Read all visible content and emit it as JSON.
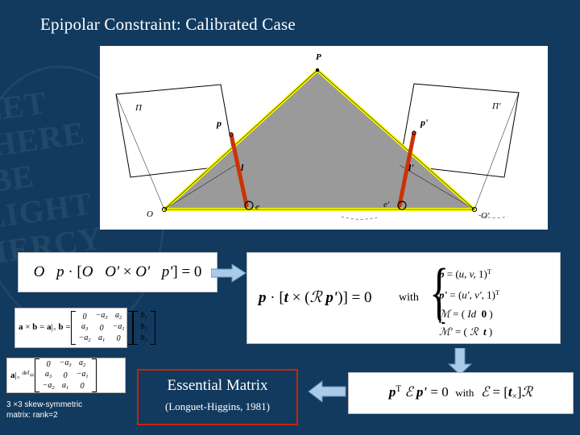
{
  "slide": {
    "title": "Epipolar Constraint: Calibrated Case",
    "background_color": "#123a5e",
    "watermark_lines": [
      "LET",
      "THERE",
      "BE",
      "LIGHT",
      "MERCY"
    ]
  },
  "figure": {
    "name": "epipolar-geometry-diagram",
    "labels": {
      "P": "P",
      "p": "p",
      "p_prime": "p'",
      "l": "l",
      "l_prime": "l'",
      "e": "e",
      "e_prime": "e'",
      "O": "O",
      "O_prime": "O'",
      "pi": "Π",
      "pi_prime": "Π'"
    },
    "colors": {
      "ray": "#ffff00",
      "segment": "#cc3300",
      "plane_fill": "#9a9a9a",
      "image_plane_outline": "#000000"
    }
  },
  "equations": {
    "eq1": {
      "name": "triple-product-equation",
      "text": "Op · [OO' × O'p'] = 0"
    },
    "eq_cross_matrix": {
      "name": "cross-product-matrix-equation",
      "text": "a × b = [a]× b =",
      "matrix_a": [
        [
          "0",
          "−a3",
          "a2"
        ],
        [
          "a3",
          "0",
          "−a1"
        ],
        [
          "−a2",
          "a1",
          "0"
        ]
      ],
      "matrix_b": [
        [
          "b1"
        ],
        [
          "b2"
        ],
        [
          "b3"
        ]
      ]
    },
    "eq_skew": {
      "name": "skew-symmetric-matrix-equation",
      "text": "[a]×",
      "superscript": "def",
      "matrix": [
        [
          "0",
          "−a3",
          "a2"
        ],
        [
          "a3",
          "0",
          "−a1"
        ],
        [
          "−a2",
          "a1",
          "0"
        ]
      ]
    },
    "eq2": {
      "name": "calibrated-epipolar-equation",
      "main": "p · [t × (ℛ p')] = 0",
      "with": "with",
      "lines": [
        "p = (u, v, 1)ᵀ",
        "p' = (u', v', 1)ᵀ",
        "ℳ = (Id  0)",
        "ℳ' = (ℛ  t)"
      ]
    },
    "eq5": {
      "name": "essential-matrix-equation",
      "main": "pᵀ ℰ p' = 0",
      "with": "with",
      "definition": "ℰ = [t×]ℛ"
    }
  },
  "labels": {
    "m_prime": "M'=(R",
    "m_prime_t": "t)",
    "skew_caption_line1": "3 ×3 skew-symmetric",
    "skew_caption_line2": "matrix: rank=2"
  },
  "essential_box": {
    "name": "essential-matrix-callout",
    "title": "Essential Matrix",
    "subtitle": "(Longuet-Higgins, 1981)",
    "border_color": "#cc2200"
  },
  "arrows": {
    "right_arrow_1": "right-arrow",
    "down_arrow": "down-arrow",
    "left_arrow": "left-arrow",
    "color": "#9dc3e6"
  }
}
